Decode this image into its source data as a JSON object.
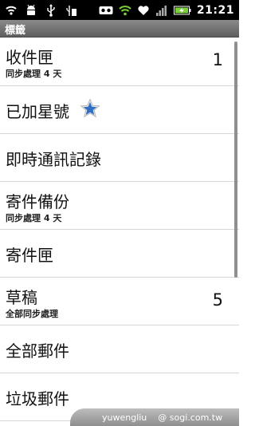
{
  "status_bar": {
    "time": "21:21",
    "icons_left": [
      "wifi-signal-icon",
      "android-debug-icon",
      "usb-icon",
      "usb-storage-icon"
    ],
    "icons_right": [
      "voicemail-icon",
      "wifi-icon",
      "sync-heart-icon",
      "signal-bars-icon",
      "battery-charging-icon"
    ]
  },
  "title": "標籤",
  "labels": [
    {
      "name": "收件匣",
      "sub": "同步處理 4 天",
      "count": "1"
    },
    {
      "name": "已加星號",
      "sub": "",
      "count": ""
    },
    {
      "name": "即時通訊記錄",
      "sub": "",
      "count": ""
    },
    {
      "name": "寄件備份",
      "sub": "同步處理 4 天",
      "count": ""
    },
    {
      "name": "寄件匣",
      "sub": "",
      "count": ""
    },
    {
      "name": "草稿",
      "sub": "全部同步處理",
      "count": "5"
    },
    {
      "name": "全部郵件",
      "sub": "",
      "count": ""
    },
    {
      "name": "垃圾郵件",
      "sub": "",
      "count": ""
    }
  ],
  "watermark": {
    "user": "yuwengliu",
    "site": "@ sogi.com.tw"
  },
  "colors": {
    "star": "#2f6fc4",
    "statusbar": "#000000"
  }
}
